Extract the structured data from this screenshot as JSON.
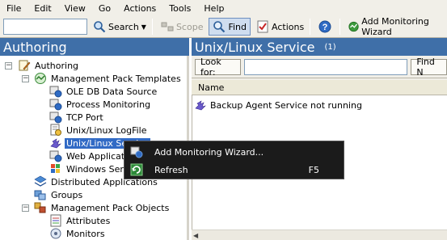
{
  "menu": [
    "File",
    "Edit",
    "View",
    "Go",
    "Actions",
    "Tools",
    "Help"
  ],
  "toolbar": {
    "search_value": "",
    "search_label": "Search",
    "scope_label": "Scope",
    "find_label": "Find",
    "actions_label": "Actions",
    "help_label": "?",
    "wizard_label": "Add Monitoring Wizard"
  },
  "left_pane": {
    "title": "Authoring",
    "tree": [
      {
        "label": "Authoring",
        "icon": "pencil-doc-icon",
        "expander": "−"
      },
      {
        "label": "Management Pack Templates",
        "icon": "template-icon",
        "expander": "−"
      },
      {
        "label": "OLE DB Data Source",
        "icon": "database-monitor-icon"
      },
      {
        "label": "Process Monitoring",
        "icon": "process-monitor-icon"
      },
      {
        "label": "TCP Port",
        "icon": "tcp-port-icon"
      },
      {
        "label": "Unix/Linux LogFile",
        "icon": "logfile-icon"
      },
      {
        "label": "Unix/Linux Service",
        "icon": "unix-service-icon",
        "selected": true
      },
      {
        "label": "Web Application",
        "icon": "web-app-icon"
      },
      {
        "label": "Windows Service",
        "icon": "windows-service-icon"
      },
      {
        "label": "Distributed Applications",
        "icon": "distributed-app-icon"
      },
      {
        "label": "Groups",
        "icon": "groups-icon"
      },
      {
        "label": "Management Pack Objects",
        "icon": "mp-objects-icon",
        "expander": "−"
      },
      {
        "label": "Attributes",
        "icon": "attributes-icon"
      },
      {
        "label": "Monitors",
        "icon": "monitors-icon"
      }
    ]
  },
  "right_pane": {
    "title": "Unix/Linux Service",
    "count": "(1)",
    "look_for_label": "Look for:",
    "look_for_value": "",
    "find_label": "Find N",
    "column_name": "Name",
    "rows": [
      {
        "name": "Backup Agent Service not running",
        "icon": "unix-service-icon"
      }
    ]
  },
  "context_menu": {
    "items": [
      {
        "label": "Add Monitoring Wizard...",
        "icon": "wizard-icon",
        "shortcut": ""
      },
      {
        "label": "Refresh",
        "icon": "refresh-icon",
        "shortcut": "F5"
      }
    ]
  }
}
